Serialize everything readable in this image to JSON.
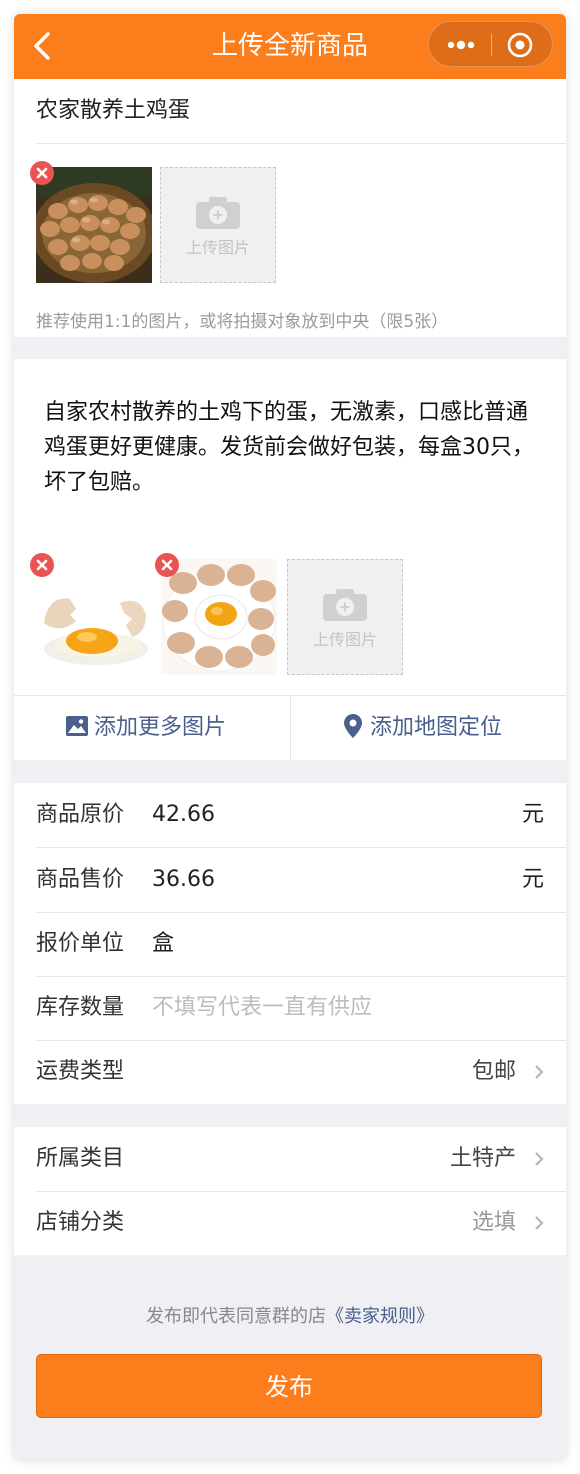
{
  "navbar": {
    "title": "上传全新商品"
  },
  "product": {
    "name": "农家散养土鸡蛋",
    "upload_label": "上传图片",
    "image_hint": "推荐使用1:1的图片，或将拍摄对象放到中央（限5张）"
  },
  "description": {
    "text": "自家农村散养的土鸡下的蛋，无激素，口感比普通鸡蛋更好更健康。发货前会做好包装，每盒30只，坏了包赔。",
    "upload_label": "上传图片",
    "add_images_label": "添加更多图片",
    "add_location_label": "添加地图定位"
  },
  "pricing": {
    "original_price": {
      "label": "商品原价",
      "value": "42.66",
      "unit": "元"
    },
    "sale_price": {
      "label": "商品售价",
      "value": "36.66",
      "unit": "元"
    },
    "price_unit": {
      "label": "报价单位",
      "value": "盒"
    },
    "stock": {
      "label": "库存数量",
      "placeholder": "不填写代表一直有供应"
    },
    "shipping": {
      "label": "运费类型",
      "value": "包邮"
    }
  },
  "category": {
    "category": {
      "label": "所属类目",
      "value": "土特产"
    },
    "shop_category": {
      "label": "店铺分类",
      "value": "选填"
    }
  },
  "footer": {
    "agreement_text": "发布即代表同意群的店",
    "agreement_link": "《卖家规则》",
    "publish_label": "发布"
  },
  "colors": {
    "accent": "#fc7d1c",
    "link": "#4a5f8c",
    "delete": "#e85454",
    "background": "#efeff4"
  },
  "icons": [
    "back-arrow-icon",
    "more-dots-icon",
    "close-circle-icon",
    "camera-icon",
    "delete-icon",
    "image-icon",
    "location-pin-icon",
    "chevron-right-icon"
  ]
}
